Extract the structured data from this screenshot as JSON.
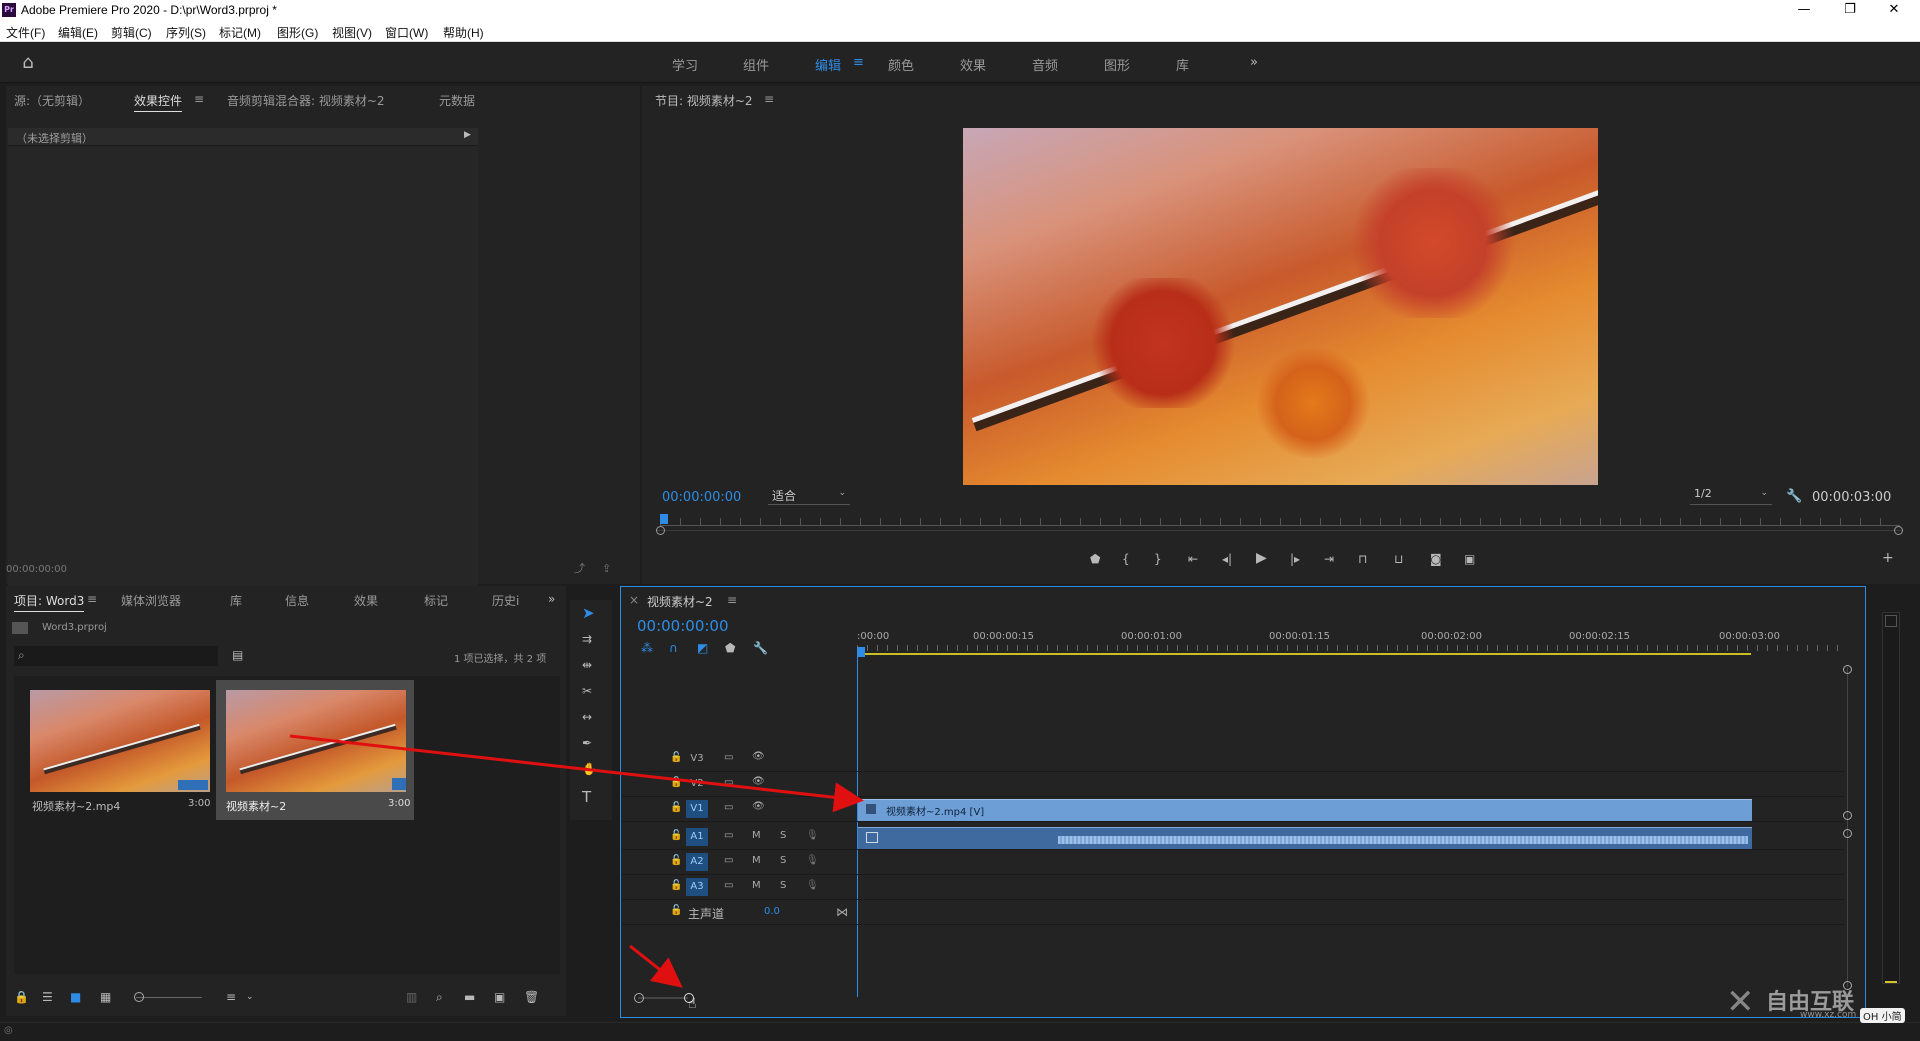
{
  "window": {
    "title": "Adobe Premiere Pro 2020 - D:\\pr\\Word3.prproj *",
    "app_icon": "Pr",
    "controls": [
      "—",
      "❐",
      "✕"
    ]
  },
  "menu": [
    "文件(F)",
    "编辑(E)",
    "剪辑(C)",
    "序列(S)",
    "标记(M)",
    "图形(G)",
    "视图(V)",
    "窗口(W)",
    "帮助(H)"
  ],
  "workspaces": {
    "tabs": [
      "学习",
      "组件",
      "编辑",
      "颜色",
      "效果",
      "音频",
      "图形",
      "库"
    ],
    "active": "编辑",
    "more": "»"
  },
  "source_panel": {
    "tabs": [
      "源:（无剪辑）",
      "效果控件",
      "音频剪辑混合器: 视频素材~2",
      "元数据"
    ],
    "active_tab": "效果控件",
    "no_clip_text": "（未选择剪辑）",
    "timecode": "00:00:00:00"
  },
  "program_monitor": {
    "title": "节目: 视频素材~2",
    "timecode_current": "00:00:00:00",
    "fit": "适合",
    "resolution": "1/2",
    "timecode_duration": "00:00:03:00",
    "playhead_fraction": 0.0
  },
  "project_panel": {
    "tabs": [
      "项目: Word3",
      "媒体浏览器",
      "库",
      "信息",
      "效果",
      "标记",
      "历史i"
    ],
    "file": "Word3.prproj",
    "search_placeholder": "",
    "selection_status": "1 项已选择，共 2 项",
    "items": [
      {
        "name": "视频素材~2.mp4",
        "duration": "3:00",
        "selected": false
      },
      {
        "name": "视频素材~2",
        "duration": "3:00",
        "selected": true
      }
    ]
  },
  "timeline": {
    "sequence_name": "视频素材~2",
    "timecode": "00:00:00:00",
    "ruler_labels": [
      ":00:00",
      "00:00:00:15",
      "00:00:01:00",
      "00:00:01:15",
      "00:00:02:00",
      "00:00:02:15",
      "00:00:03:00"
    ],
    "tracks": [
      {
        "id": "V3",
        "active": false,
        "type": "video"
      },
      {
        "id": "V2",
        "active": false,
        "type": "video"
      },
      {
        "id": "V1",
        "active": true,
        "type": "video"
      },
      {
        "id": "A1",
        "active": true,
        "type": "audio"
      },
      {
        "id": "A2",
        "active": true,
        "type": "audio"
      },
      {
        "id": "A3",
        "active": true,
        "type": "audio"
      }
    ],
    "master": {
      "label": "主声道",
      "value": "0.0"
    },
    "video_clip": "视频素材~2.mp4 [V]",
    "mute": "M",
    "solo": "S"
  },
  "tools": [
    "selection-tool",
    "track-select-tool",
    "ripple-edit-tool",
    "razor-tool",
    "slip-tool",
    "pen-tool",
    "hand-tool",
    "type-tool"
  ],
  "watermark": {
    "text": "自由互联",
    "sub": "www.xz.com",
    "brand": "OH 小简"
  },
  "colors": {
    "accent": "#2f8ce6",
    "clip_video": "#6d9fd6",
    "clip_audio": "#5a88bf",
    "annotation_arrow": "#e01010"
  }
}
